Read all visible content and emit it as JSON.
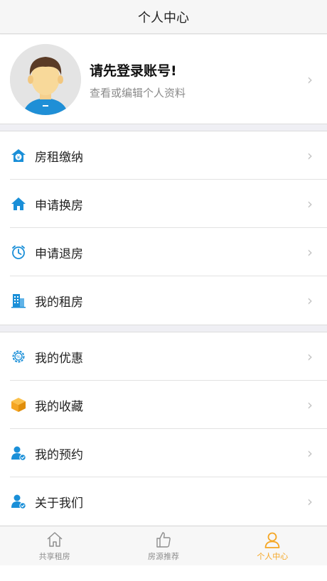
{
  "header": {
    "title": "个人中心"
  },
  "profile": {
    "title": "请先登录账号!",
    "subtitle": "查看或编辑个人资料"
  },
  "menu_group_1": [
    {
      "label": "房租缴纳",
      "icon": "rent-payment-icon"
    },
    {
      "label": "申请换房",
      "icon": "house-icon"
    },
    {
      "label": "申请退房",
      "icon": "alarm-clock-icon"
    },
    {
      "label": "我的租房",
      "icon": "building-icon"
    }
  ],
  "menu_group_2": [
    {
      "label": "我的优惠",
      "icon": "discount-gear-icon"
    },
    {
      "label": "我的收藏",
      "icon": "box-icon"
    },
    {
      "label": "我的预约",
      "icon": "user-check-icon"
    },
    {
      "label": "关于我们",
      "icon": "user-check-icon"
    }
  ],
  "tabbar": [
    {
      "label": "共享租房",
      "icon": "home-outline-icon",
      "active": false
    },
    {
      "label": "房源推荐",
      "icon": "thumbs-up-icon",
      "active": false
    },
    {
      "label": "个人中心",
      "icon": "person-icon",
      "active": true
    }
  ],
  "colors": {
    "accent": "#f5a623",
    "icon_blue": "#1a8fd8",
    "icon_orange": "#f5a623"
  }
}
